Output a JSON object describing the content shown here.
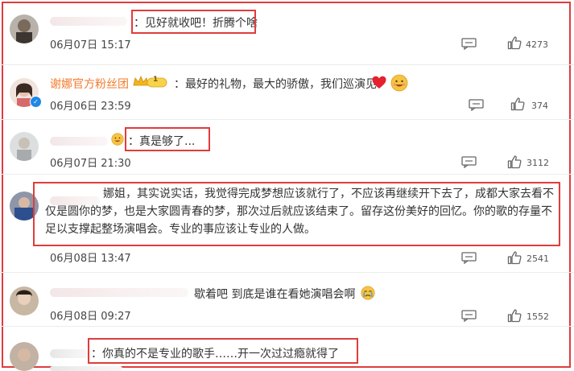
{
  "comments": [
    {
      "text": "：见好就收吧！折腾个啥",
      "time": "06月07日 15:17",
      "likes": "4273"
    },
    {
      "name": "谢娜官方粉丝团",
      "vip_level": "1",
      "text": "：最好的礼物，最大的骄傲，我们巡演见",
      "time": "06月06日 23:59",
      "likes": "374"
    },
    {
      "text": "：真是够了...",
      "time": "06月07日 21:30",
      "likes": "3112"
    },
    {
      "text": "娜姐，其实说实话，我觉得完成梦想应该就行了，不应该再继续开下去了，成都大家去看不仅是圆你的梦，也是大家圆青春的梦，那次过后就应该结束了。留存这份美好的回忆。你的歌的存量不足以支撑起整场演唱会。专业的事应该让专业的人做。",
      "time": "06月08日 13:47",
      "likes": "2541"
    },
    {
      "text": "歇着吧 到底是谁在看她演唱会啊",
      "time": "06月08日 09:27",
      "likes": "1552"
    },
    {
      "text": "：你真的不是专业的歌手……开一次过过瘾就得了"
    }
  ],
  "icons": {
    "comment": "comment-icon",
    "like": "thumbs-up-icon",
    "heart": "red-heart-emoji",
    "cry": "crying-emoji",
    "smile": "grinning-emoji",
    "vip": "vip-crown-badge",
    "verified": "verified-badge"
  },
  "colors": {
    "highlight": "#e03c3c",
    "fan_name": "#f47b2c",
    "verified": "#1e88e5"
  }
}
